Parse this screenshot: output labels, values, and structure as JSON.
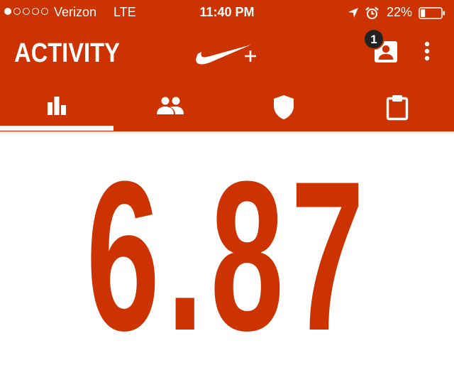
{
  "status_bar": {
    "signal_dots_filled": 1,
    "signal_dots_total": 5,
    "carrier": "Verizon",
    "network": "LTE",
    "time": "11:40 PM",
    "battery_percent": "22%",
    "battery_level": 0.22
  },
  "app_bar": {
    "title": "ACTIVITY",
    "logo": "nike-plus-logo",
    "profile_badge": "1"
  },
  "tabs": [
    {
      "icon": "bar-chart-icon",
      "selected": true
    },
    {
      "icon": "people-icon",
      "selected": false
    },
    {
      "icon": "shield-icon",
      "selected": false
    },
    {
      "icon": "clipboard-icon",
      "selected": false
    }
  ],
  "main": {
    "distance_value": "6.87"
  },
  "colors": {
    "brand": "#cc3300",
    "text_on_brand": "#ffffff",
    "background": "#ffffff"
  }
}
